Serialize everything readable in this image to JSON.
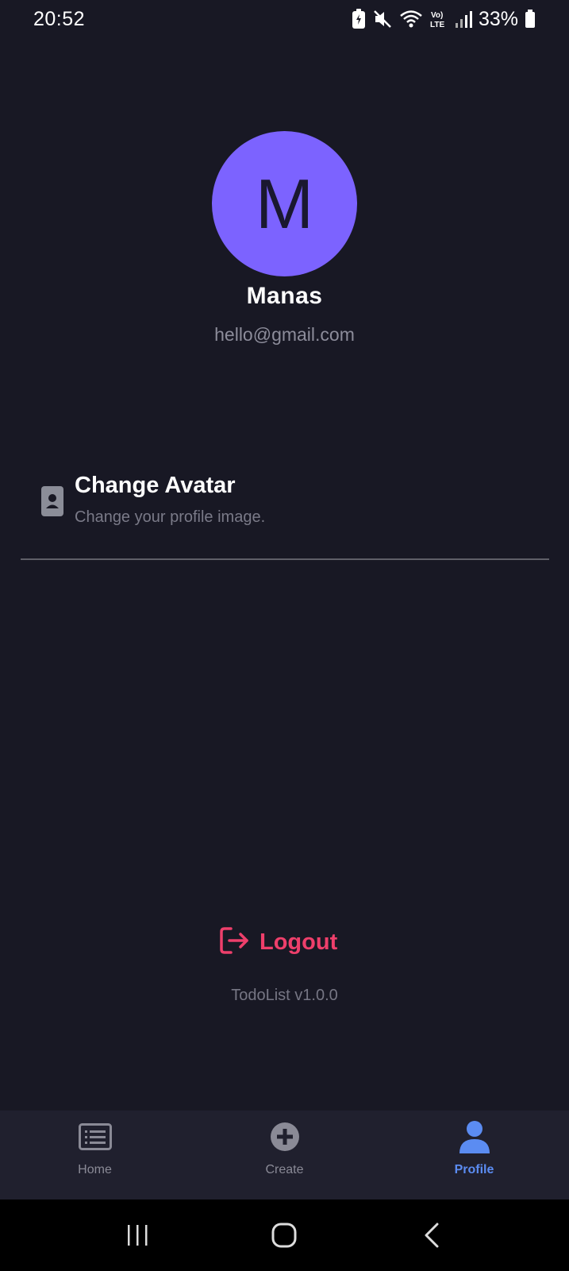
{
  "status_bar": {
    "time": "20:52",
    "battery_percent": "33%",
    "icons": [
      "battery-saver-icon",
      "mute-icon",
      "wifi-icon",
      "volte-icon",
      "signal-icon",
      "battery-icon"
    ]
  },
  "profile": {
    "avatar_letter": "M",
    "name": "Manas",
    "email": "hello@gmail.com",
    "avatar_color": "#7c63ff"
  },
  "menu": {
    "items": [
      {
        "title": "Change Avatar",
        "description": "Change your profile image.",
        "icon": "contact-card-icon"
      }
    ]
  },
  "logout": {
    "label": "Logout",
    "color": "#ee3f6b",
    "icon": "logout-icon"
  },
  "footer": {
    "version": "TodoList v1.0.0"
  },
  "bottom_nav": {
    "active": "Profile",
    "active_color": "#5b8cf2",
    "items": [
      {
        "label": "Home",
        "icon": "list-icon"
      },
      {
        "label": "Create",
        "icon": "plus-circle-icon"
      },
      {
        "label": "Profile",
        "icon": "person-icon"
      }
    ]
  },
  "system_nav": {
    "buttons": [
      "recents-icon",
      "home-icon",
      "back-icon"
    ]
  }
}
